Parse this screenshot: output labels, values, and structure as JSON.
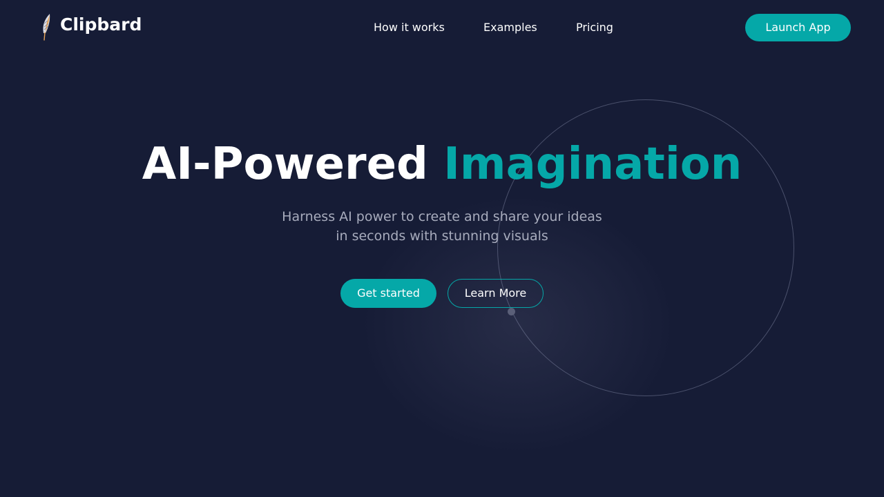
{
  "brand": {
    "name": "Clipbard",
    "logo_icon": "feather-icon"
  },
  "nav": {
    "items": [
      {
        "label": "How it works"
      },
      {
        "label": "Examples"
      },
      {
        "label": "Pricing"
      }
    ],
    "cta_label": "Launch App"
  },
  "hero": {
    "title_main": "AI-Powered",
    "title_accent": "Imagination",
    "subtitle_line1": "Harness AI power to create and share your ideas",
    "subtitle_line2": "in seconds with stunning visuals",
    "primary_button": "Get started",
    "secondary_button": "Learn More"
  },
  "colors": {
    "background": "#161c36",
    "accent": "#05a8a8",
    "text": "#ffffff",
    "muted_text": "#a8acbd"
  }
}
